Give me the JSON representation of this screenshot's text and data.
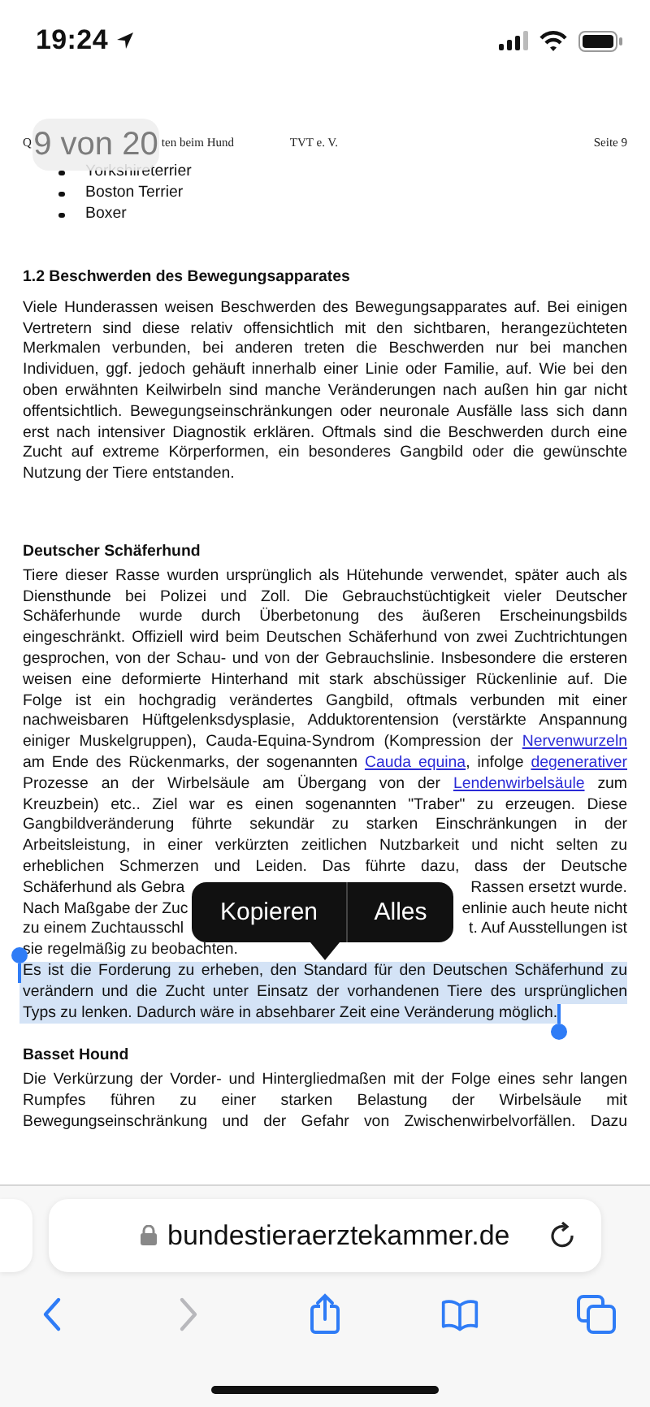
{
  "status_bar": {
    "time": "19:24"
  },
  "document": {
    "running_header": {
      "left": "Q",
      "title_fragment": "ten beim Hund",
      "center": "TVT e. V.",
      "right": "Seite 9"
    },
    "page_indicator": "9 von 20",
    "blocks": [
      {
        "kind": "bullets",
        "items": [
          "Yorkshireterrier",
          "Boston Terrier",
          "Boxer"
        ]
      },
      {
        "kind": "heading",
        "text": "1.2 Beschwerden des Bewegungsapparates"
      },
      {
        "kind": "paragraph",
        "selected": false,
        "continues": false,
        "lines": [
          "Viele Hunderassen weisen Beschwerden des Bewegungsapparates auf. Bei einigen",
          "Vertretern sind diese relativ offensichtlich mit den sichtbaren, herangezüchteten",
          "Merkmalen verbunden, bei anderen treten die Beschwerden nur bei manchen",
          "Individuen, ggf. jedoch gehäuft innerhalb einer Linie oder Familie, auf. Wie bei den",
          "oben erwähnten Keilwirbeln sind manche Veränderungen nach außen hin gar nicht",
          "offentsichtlich. Bewegungseinschränkungen oder neuronale Ausfälle lass sich dann",
          "erst nach intensiver Diagnostik erklären. Oftmals sind die Beschwerden durch eine",
          "Zucht auf extreme Körperformen, ein besonderes Gangbild oder die gewünschte",
          "Nutzung der Tiere entstanden."
        ]
      },
      {
        "kind": "subheading",
        "text": "Deutscher Schäferhund"
      },
      {
        "kind": "paragraph",
        "selected": false,
        "continues": false,
        "lines": [
          "Tiere dieser Rasse wurden ursprünglich als Hütehunde verwendet, später auch als",
          "Diensthunde bei Polizei und Zoll. Die Gebrauchstüchtigkeit vieler Deutscher",
          "Schäferhunde wurde durch Überbetonung des äußeren Erscheinungsbilds",
          "eingeschränkt. Offiziell wird beim Deutschen Schäferhund von zwei Zuchtrichtungen",
          "gesprochen, von der Schau- und von der Gebrauchslinie. Insbesondere die ersteren",
          "weisen eine deformierte Hinterhand mit stark abschüssiger Rückenlinie auf. Die",
          "Folge ist ein hochgradig verändertes Gangbild, oftmals verbunden mit einer",
          "nachweisbaren Hüftgelenksdysplasie, Adduktorentension (verstärkte Anspannung",
          [
            {
              "kind": "text",
              "text": "einiger Muskelgruppen), Cauda-Equina-Syndrom (Kompression der "
            },
            {
              "kind": "link",
              "text": "Nervenwurzeln"
            }
          ],
          [
            {
              "kind": "text",
              "text": "am Ende des Rückenmarks, der sogenannten "
            },
            {
              "kind": "link",
              "text": "Cauda equina"
            },
            {
              "kind": "text",
              "text": ", infolge "
            },
            {
              "kind": "link",
              "text": "degenerativer"
            }
          ],
          [
            {
              "kind": "text",
              "text": "Prozesse an der Wirbelsäule am Übergang von der "
            },
            {
              "kind": "link",
              "text": "Lendenwirbelsäule"
            },
            {
              "kind": "text",
              "text": " zum"
            }
          ],
          "Kreuzbein) etc.. Ziel war es einen sogenannten \"Traber\" zu erzeugen. Diese",
          "Gangbildveränderung führte sekundär zu starken Einschränkungen in der",
          "Arbeitsleistung, in einer verkürzten zeitlichen Nutzbarkeit und nicht selten zu",
          "erheblichen Schmerzen und Leiden. Das führte dazu, dass der Deutsche",
          [
            {
              "kind": "text",
              "text": "Schäferhund als Gebra"
            },
            {
              "kind": "gap"
            },
            {
              "kind": "text",
              "text": "Rassen ersetzt wurde."
            }
          ],
          [
            {
              "kind": "text",
              "text": "Nach Maßgabe der Zuc"
            },
            {
              "kind": "gap"
            },
            {
              "kind": "text",
              "text": "enlinie auch heute nicht"
            }
          ],
          [
            {
              "kind": "text",
              "text": "zu einem Zuchtausschl"
            },
            {
              "kind": "gap"
            },
            {
              "kind": "text",
              "text": "t. Auf Ausstellungen ist"
            }
          ],
          "sie regelmäßig zu beobachten."
        ]
      },
      {
        "kind": "paragraph",
        "selected": true,
        "continues": false,
        "lines": [
          "Es ist die Forderung zu erheben, den Standard für den Deutschen Schäferhund zu",
          "verändern und die Zucht unter Einsatz der vorhandenen Tiere des ursprünglichen",
          "Typs zu lenken. Dadurch wäre in absehbarer Zeit eine Veränderung möglich."
        ]
      },
      {
        "kind": "subheading",
        "text": "Basset Hound"
      },
      {
        "kind": "paragraph",
        "selected": false,
        "continues": true,
        "lines": [
          "Die Verkürzung der Vorder- und Hintergliedmaßen mit der Folge eines sehr langen",
          "Rumpfes führen zu einer starken Belastung der Wirbelsäule mit",
          "Bewegungseinschränkung und der Gefahr von Zwischenwirbelvorfällen. Dazu"
        ]
      }
    ]
  },
  "context_menu": {
    "items": [
      {
        "label": "Kopieren"
      },
      {
        "label": "Alles"
      }
    ]
  },
  "browser": {
    "url": "bundestieraerztekammer.de",
    "toolbar": [
      {
        "kind": "back",
        "disabled": false
      },
      {
        "kind": "forward",
        "disabled": true
      },
      {
        "kind": "share",
        "disabled": false
      },
      {
        "kind": "bookmarks",
        "disabled": false
      },
      {
        "kind": "tabs",
        "disabled": false
      }
    ]
  }
}
